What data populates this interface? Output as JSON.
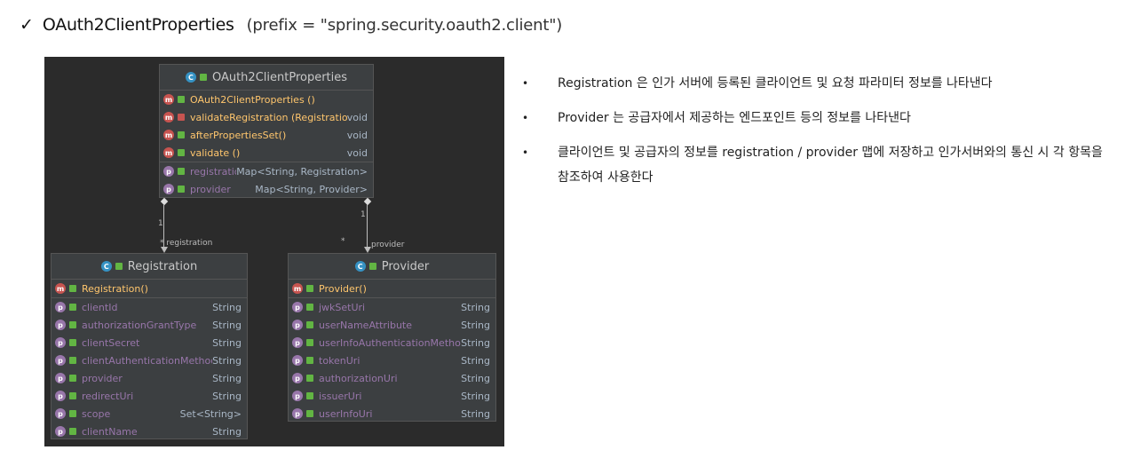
{
  "header": {
    "check": "✓",
    "title": "OAuth2ClientProperties",
    "prefix": "(prefix = \"spring.security.oauth2.client\")"
  },
  "diagram": {
    "main_class": {
      "name": "OAuth2ClientProperties",
      "methods": [
        {
          "name": "OAuth2ClientProperties ()",
          "type": ""
        },
        {
          "name": "validateRegistration (Registration)",
          "type": "void"
        },
        {
          "name": "afterPropertiesSet()",
          "type": "void"
        },
        {
          "name": "validate ()",
          "type": "void"
        }
      ],
      "fields": [
        {
          "name": "registration",
          "type": "Map<String, Registration>"
        },
        {
          "name": "provider",
          "type": "Map<String, Provider>"
        }
      ]
    },
    "registration_class": {
      "name": "Registration",
      "methods": [
        {
          "name": "Registration()"
        }
      ],
      "fields": [
        {
          "name": "clientId",
          "type": "String"
        },
        {
          "name": "authorizationGrantType",
          "type": "String"
        },
        {
          "name": "clientSecret",
          "type": "String"
        },
        {
          "name": "clientAuthenticationMethod",
          "type": "String"
        },
        {
          "name": "provider",
          "type": "String"
        },
        {
          "name": "redirectUri",
          "type": "String"
        },
        {
          "name": "scope",
          "type": "Set<String>"
        },
        {
          "name": "clientName",
          "type": "String"
        }
      ]
    },
    "provider_class": {
      "name": "Provider",
      "methods": [
        {
          "name": "Provider()"
        }
      ],
      "fields": [
        {
          "name": "jwkSetUri",
          "type": "String"
        },
        {
          "name": "userNameAttribute",
          "type": "String"
        },
        {
          "name": "userInfoAuthenticationMethod",
          "type": "String"
        },
        {
          "name": "tokenUri",
          "type": "String"
        },
        {
          "name": "authorizationUri",
          "type": "String"
        },
        {
          "name": "issuerUri",
          "type": "String"
        },
        {
          "name": "userInfoUri",
          "type": "String"
        }
      ]
    },
    "links": {
      "left_multiplicity_top": "1",
      "left_label": "* registration",
      "right_multiplicity_top": "1",
      "right_star": "*",
      "right_label": "provider"
    },
    "badges": {
      "method": "m",
      "field": "p",
      "class": "C"
    }
  },
  "bullets": [
    "Registration 은 인가 서버에 등록된 클라이언트 및 요청 파라미터 정보를 나타낸다",
    "Provider 는 공급자에서 제공하는 엔드포인트 등의 정보를 나타낸다",
    "클라이언트 및 공급자의 정보를 registration / provider 맵에 저장하고 인가서버와의 통신 시 각 항목을 참조하여 사용한다"
  ],
  "bullet_symbol": "•"
}
